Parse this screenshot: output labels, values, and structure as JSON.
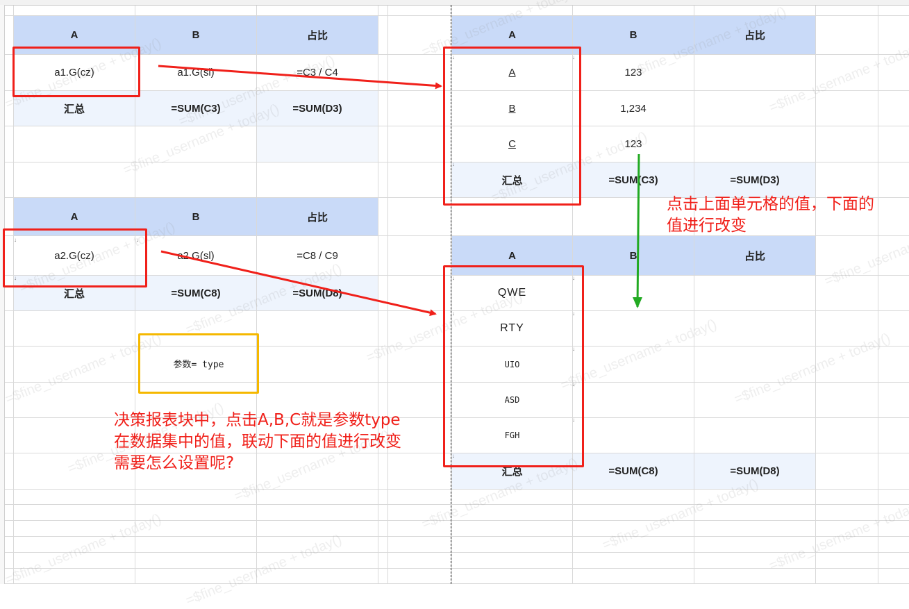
{
  "left_top_table": {
    "header": [
      "A",
      "B",
      "占比"
    ],
    "row": [
      "a1.G(cz)",
      "a1.G(sl)",
      "=C3 / C4"
    ],
    "summary": [
      "汇总",
      "=SUM(C3)",
      "=SUM(D3)"
    ]
  },
  "left_bottom_table": {
    "header": [
      "A",
      "B",
      "占比"
    ],
    "row": [
      "a2.G(cz)",
      "a2.G(sl)",
      "=C8 / C9"
    ],
    "summary": [
      "汇总",
      "=SUM(C8)",
      "=SUM(D8)"
    ]
  },
  "param_label": "参数= type",
  "right_top_table": {
    "header": [
      "A",
      "B",
      "占比"
    ],
    "rows": [
      {
        "a": "A",
        "b": "123"
      },
      {
        "a": "B",
        "b": "1,234"
      },
      {
        "a": "C",
        "b": "123"
      }
    ],
    "summary": [
      "汇总",
      "=SUM(C3)",
      "=SUM(D3)"
    ]
  },
  "right_bottom_table": {
    "header": [
      "A",
      "B",
      "占比"
    ],
    "rows": [
      "QWE",
      "RTY",
      "UIO",
      "ASD",
      "FGH"
    ],
    "summary": [
      "汇总",
      "=SUM(C8)",
      "=SUM(D8)"
    ]
  },
  "annotation_right": {
    "line1": "点击上面单元格的值，下面的",
    "line2": "值进行改变"
  },
  "annotation_left": {
    "line1": "决策报表块中，点击A,B,C就是参数type",
    "line2": "在数据集中的值，联动下面的值进行改变",
    "line3": "需要怎么设置呢?"
  },
  "watermark": "=$fine_username + today()",
  "colors": {
    "header_bg": "#c9daf8",
    "summary_bg": "#eef4fd",
    "red": "#f0201a",
    "green": "#22aa22",
    "yellow": "#f5b800"
  }
}
